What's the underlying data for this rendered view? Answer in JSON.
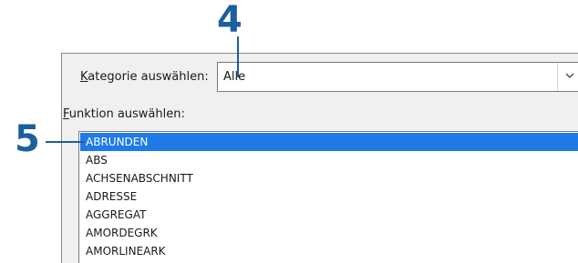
{
  "dialog": {
    "category_label_accel": "K",
    "category_label_rest": "ategorie auswählen:",
    "category_value": "Alle",
    "function_label_accel": "F",
    "function_label_rest": "unktion auswählen:"
  },
  "functions": [
    "ABRUNDEN",
    "ABS",
    "ACHSENABSCHNITT",
    "ADRESSE",
    "AGGREGAT",
    "AMORDEGRK",
    "AMORLINEARK"
  ],
  "selected_index": 0,
  "callouts": {
    "category": "4",
    "list": "5"
  },
  "colors": {
    "selection": "#1e7be6",
    "callout": "#1c5f9e"
  },
  "icons": {
    "combo_button": "chevron-down-icon"
  }
}
